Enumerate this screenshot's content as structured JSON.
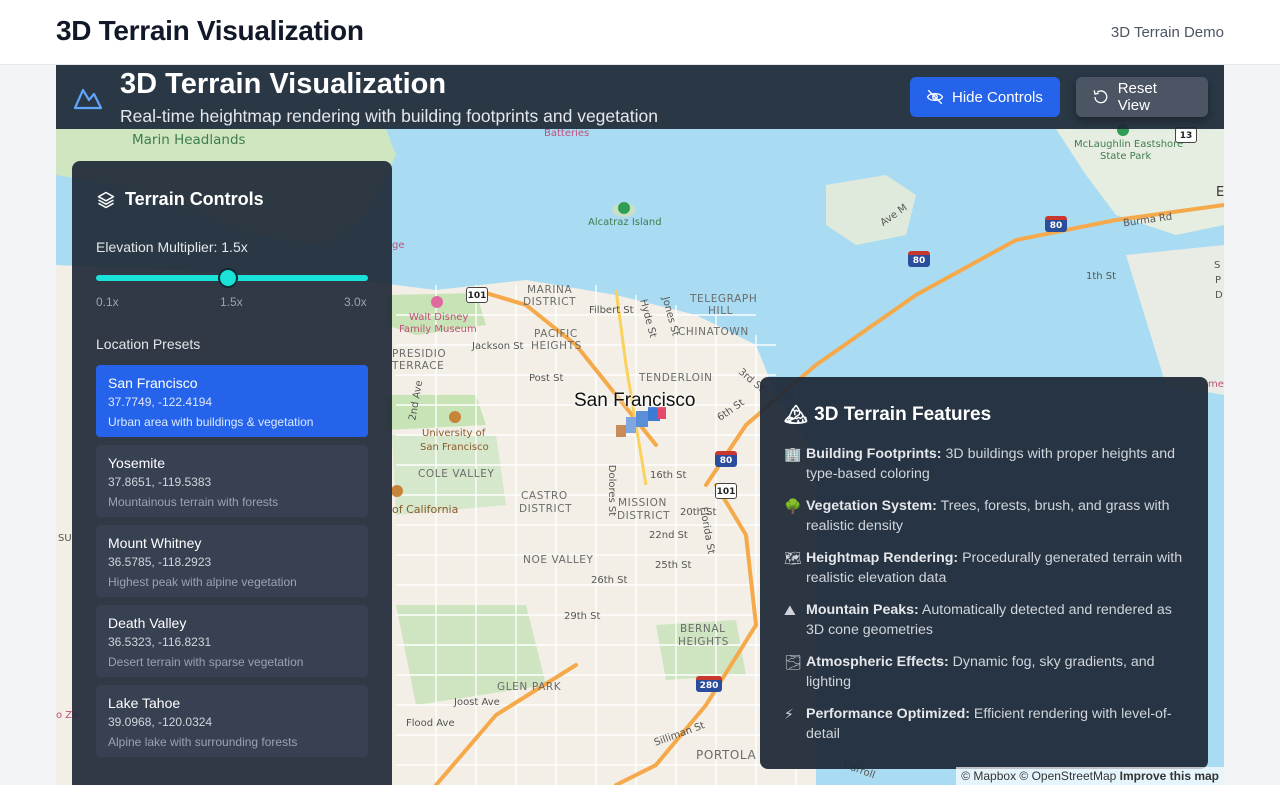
{
  "page": {
    "title": "3D Terrain Visualization",
    "nav_label": "3D Terrain Demo"
  },
  "viz": {
    "title": "3D Terrain Visualization",
    "subtitle": "Real-time heightmap rendering with building footprints and vegetation",
    "hide_controls_label": "Hide Controls",
    "reset_view_label": "Reset View",
    "icons": {
      "logo": "mountain-icon",
      "hide": "eye-off-icon",
      "reset": "reset-icon"
    }
  },
  "controls": {
    "title": "Terrain Controls",
    "elevation_label": "Elevation Multiplier: 1.5x",
    "elevation": {
      "min": 0.1,
      "max": 3.0,
      "value": 1.5
    },
    "ticks": {
      "min": "0.1x",
      "mid": "1.5x",
      "max": "3.0x"
    },
    "presets_label": "Location Presets",
    "presets": [
      {
        "name": "San Francisco",
        "coords": "37.7749, -122.4194",
        "desc": "Urban area with buildings & vegetation",
        "active": true
      },
      {
        "name": "Yosemite",
        "coords": "37.8651, -119.5383",
        "desc": "Mountainous terrain with forests",
        "active": false
      },
      {
        "name": "Mount Whitney",
        "coords": "36.5785, -118.2923",
        "desc": "Highest peak with alpine vegetation",
        "active": false
      },
      {
        "name": "Death Valley",
        "coords": "36.5323, -116.8231",
        "desc": "Desert terrain with sparse vegetation",
        "active": false
      },
      {
        "name": "Lake Tahoe",
        "coords": "39.0968, -120.0324",
        "desc": "Alpine lake with surrounding forests",
        "active": false
      }
    ]
  },
  "features": {
    "title": "3D Terrain Features",
    "title_emoji": "🏔",
    "items": [
      {
        "emoji": "🏢",
        "name": "Building Footprints:",
        "text": " 3D buildings with proper heights and type-based coloring"
      },
      {
        "emoji": "🌳",
        "name": "Vegetation System:",
        "text": " Trees, forests, brush, and grass with realistic density"
      },
      {
        "emoji": "🗺",
        "name": "Heightmap Rendering:",
        "text": " Procedurally generated terrain with realistic elevation data"
      },
      {
        "emoji": "⛰",
        "name": "Mountain Peaks:",
        "text": " Automatically detected and rendered as 3D cone geometries"
      },
      {
        "emoji": "🌫",
        "name": "Atmospheric Effects:",
        "text": " Dynamic fog, sky gradients, and lighting"
      },
      {
        "emoji": "⚡",
        "name": "Performance Optimized:",
        "text": " Efficient rendering with level-of-detail"
      }
    ]
  },
  "map": {
    "city": "San Francisco",
    "labels": {
      "marin": "Marin Headlands",
      "batteries": "Batteries",
      "alcatraz": "Alcatraz Island",
      "marina": "MARINA",
      "district": "DISTRICT",
      "pacific": "PACIFIC",
      "heights": "HEIGHTS",
      "telegraph": "TELEGRAPH",
      "hill": "HILL",
      "chinatown": "CHINATOWN",
      "tenderloin": "TENDERLOIN",
      "presidio": "PRESIDIO",
      "terrace": "TERRACE",
      "walt": "Walt Disney",
      "familymuseum": "Family Museum",
      "univ": "University of",
      "univ2": "San Francisco",
      "cole": "COLE VALLEY",
      "castro": "CASTRO",
      "castro2": "DISTRICT",
      "mission": "MISSION",
      "mission2": "DISTRICT",
      "noe": "NOE VALLEY",
      "bernal": "BERNAL",
      "bernal2": "HEIGHTS",
      "glen": "GLEN PARK",
      "portola": "PORTOLA",
      "ofcal": "of California",
      "mclaughlin": "McLaughlin Eastshore",
      "statepark": "State Park",
      "filbert": "Filbert St",
      "jackson": "Jackson St",
      "post": "Post St",
      "hyde": "Hyde St",
      "jones": "Jones St",
      "third": "3rd St",
      "sixth": "6th St",
      "sixteenth": "16th St",
      "twentieth": "20th St",
      "twentysecond": "22nd St",
      "twentyfifth": "25th St",
      "twentysixth": "26th St",
      "twentyninth": "29th St",
      "dolores": "Dolores St",
      "florida": "Florida St",
      "second": "2nd Ave",
      "joost": "Joost Ave",
      "flood": "Flood Ave",
      "silliman": "Silliman St",
      "burma": "Burma Rd",
      "ave_m": "Ave M",
      "first": "1th St",
      "carroll": "Carroll",
      "ge": "ge",
      "su": "SU",
      "e": "E",
      "sh": "S",
      "pd": "P",
      "d": "D",
      "zo": "o Zo",
      "med": "med"
    },
    "shields": {
      "us101": "101",
      "i80": "80",
      "i280": "280",
      "ca13": "13"
    },
    "attribution": {
      "text": "© Mapbox © OpenStreetMap",
      "improve": "Improve this map"
    }
  }
}
